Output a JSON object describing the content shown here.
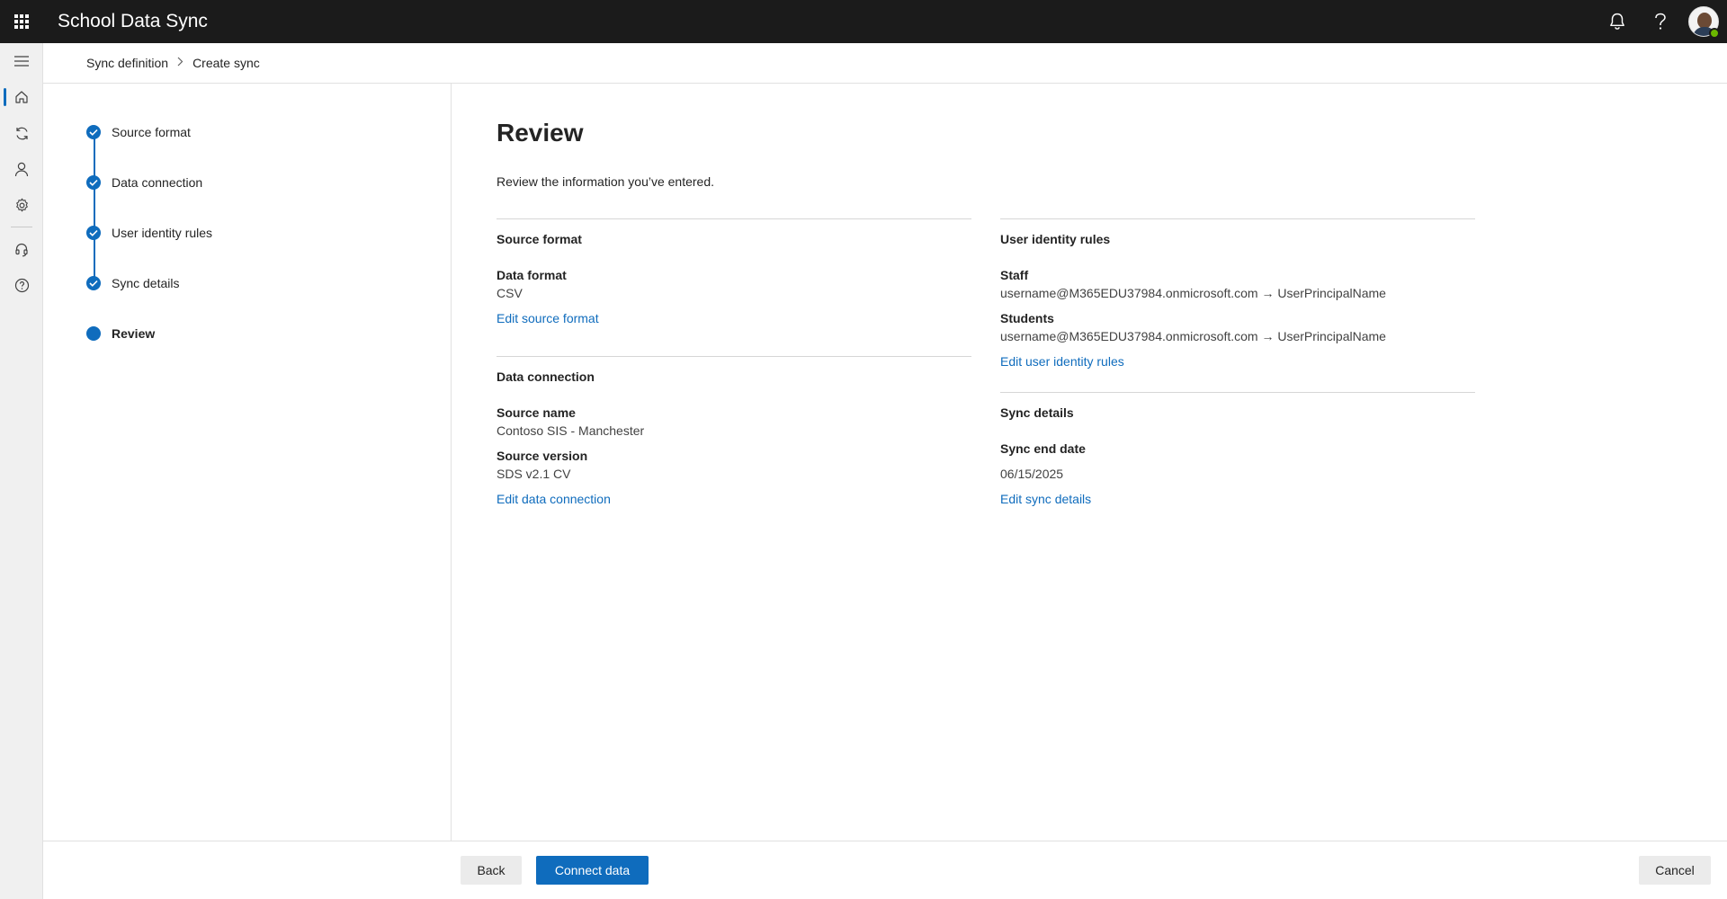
{
  "app": {
    "title": "School Data Sync"
  },
  "breadcrumb": {
    "parent": "Sync definition",
    "current": "Create sync"
  },
  "steps": [
    {
      "label": "Source format",
      "status": "complete"
    },
    {
      "label": "Data connection",
      "status": "complete"
    },
    {
      "label": "User identity rules",
      "status": "complete"
    },
    {
      "label": "Sync details",
      "status": "complete"
    },
    {
      "label": "Review",
      "status": "current"
    }
  ],
  "review": {
    "title": "Review",
    "description": "Review the information you’ve entered.",
    "source_format": {
      "title": "Source format",
      "data_format_label": "Data format",
      "data_format_value": "CSV",
      "edit_link": "Edit source format"
    },
    "data_connection": {
      "title": "Data connection",
      "source_name_label": "Source name",
      "source_name_value": "Contoso SIS - Manchester",
      "source_version_label": "Source version",
      "source_version_value": "SDS v2.1 CV",
      "edit_link": "Edit data connection"
    },
    "user_identity_rules": {
      "title": "User identity rules",
      "staff_label": "Staff",
      "staff_value": "username@M365EDU37984.onmicrosoft.com → UserPrincipalName",
      "students_label": "Students",
      "students_value": "username@M365EDU37984.onmicrosoft.com → UserPrincipalName",
      "edit_link": "Edit user identity rules"
    },
    "sync_details": {
      "title": "Sync details",
      "end_date_label": "Sync end date",
      "end_date_value": "06/15/2025",
      "edit_link": "Edit sync details"
    }
  },
  "footer": {
    "back": "Back",
    "connect": "Connect data",
    "cancel": "Cancel"
  },
  "colors": {
    "accent": "#0f6cbd",
    "topbar": "#1b1b1b",
    "presence": "#6bb700"
  }
}
